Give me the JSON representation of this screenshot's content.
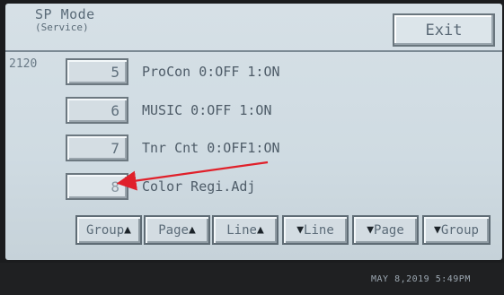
{
  "header": {
    "title": "SP Mode",
    "subtitle": "(Service)",
    "exit_label": "Exit"
  },
  "code": "2120",
  "rows": [
    {
      "number": "5",
      "label": "ProCon 0:OFF 1:ON"
    },
    {
      "number": "6",
      "label": "MUSIC 0:OFF 1:ON"
    },
    {
      "number": "7",
      "label": "Tnr Cnt 0:OFF1:ON"
    },
    {
      "number": "8",
      "label": "Color Regi.Adj"
    }
  ],
  "nav": {
    "group_up": "Group",
    "page_up": "Page",
    "line_up": "Line",
    "line_down": "Line",
    "page_down": "Page",
    "group_down": "Group",
    "up_arrow": "▲",
    "down_arrow": "▼"
  },
  "status": {
    "timestamp": "MAY   8,2019  5:49PM"
  },
  "colors": {
    "screen_bg": "#d3dde3",
    "button_border": "#6c7880",
    "text": "#4e5c68",
    "annotation_arrow": "#e0202a",
    "bezel": "#1b1c1e"
  }
}
